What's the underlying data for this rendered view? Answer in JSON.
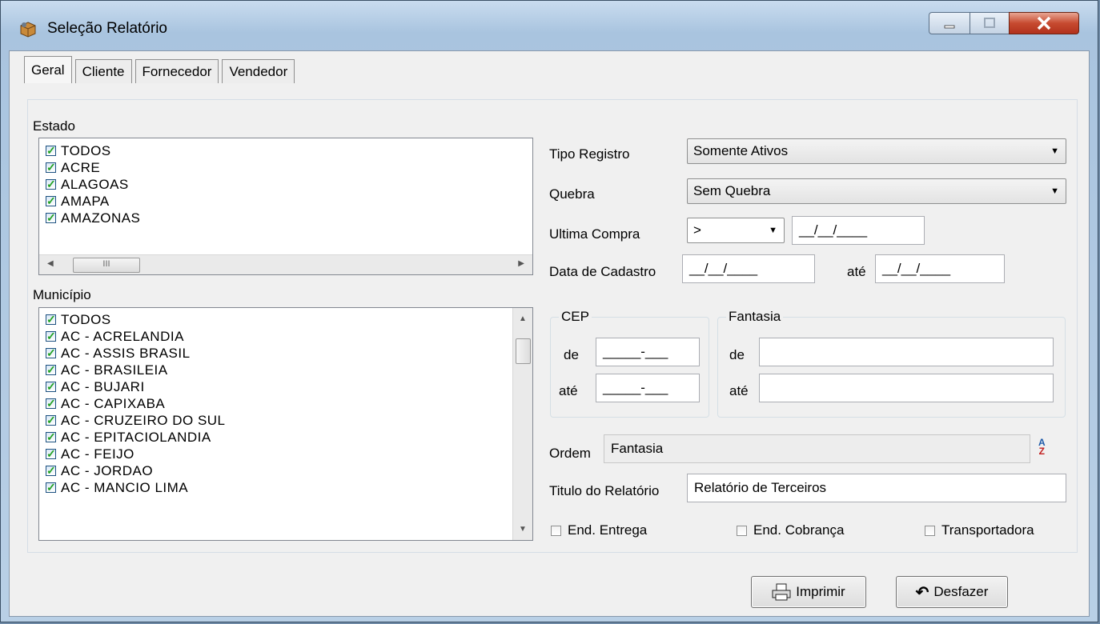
{
  "window": {
    "title": "Seleção Relatório"
  },
  "tabs": [
    {
      "label": "Geral"
    },
    {
      "label": "Cliente"
    },
    {
      "label": "Fornecedor"
    },
    {
      "label": "Vendedor"
    }
  ],
  "estado": {
    "label": "Estado",
    "items": [
      "TODOS",
      "ACRE",
      "ALAGOAS",
      "AMAPA",
      "AMAZONAS"
    ],
    "scroll_grip": "III"
  },
  "municipio": {
    "label": "Município",
    "items": [
      "TODOS",
      "AC - ACRELANDIA",
      "AC - ASSIS BRASIL",
      "AC - BRASILEIA",
      "AC - BUJARI",
      "AC - CAPIXABA",
      "AC - CRUZEIRO DO SUL",
      "AC - EPITACIOLANDIA",
      "AC - FEIJO",
      "AC - JORDAO",
      "AC - MANCIO LIMA"
    ]
  },
  "form": {
    "tipo_registro": {
      "label": "Tipo Registro",
      "value": "Somente Ativos"
    },
    "quebra": {
      "label": "Quebra",
      "value": "Sem Quebra"
    },
    "ultima_compra": {
      "label": "Ultima Compra",
      "operator": ">",
      "date": "__/__/____"
    },
    "data_cadastro": {
      "label": "Data de Cadastro",
      "from": "__/__/____",
      "to_label": "até",
      "to": "__/__/____"
    },
    "cep": {
      "label": "CEP",
      "de_label": "de",
      "de_value": "_____-___",
      "ate_label": "até",
      "ate_value": "_____-___"
    },
    "fantasia": {
      "label": "Fantasia",
      "de_label": "de",
      "de_value": "",
      "ate_label": "até",
      "ate_value": ""
    },
    "ordem": {
      "label": "Ordem",
      "value": "Fantasia"
    },
    "titulo": {
      "label": "Titulo do Relatório",
      "value": "Relatório de Terceiros"
    },
    "end_entrega": {
      "label": "End. Entrega",
      "checked": false
    },
    "end_cobranca": {
      "label": "End. Cobrança",
      "checked": false
    },
    "transportadora": {
      "label": "Transportadora",
      "checked": false
    }
  },
  "buttons": {
    "imprimir": "Imprimir",
    "desfazer": "Desfazer"
  }
}
